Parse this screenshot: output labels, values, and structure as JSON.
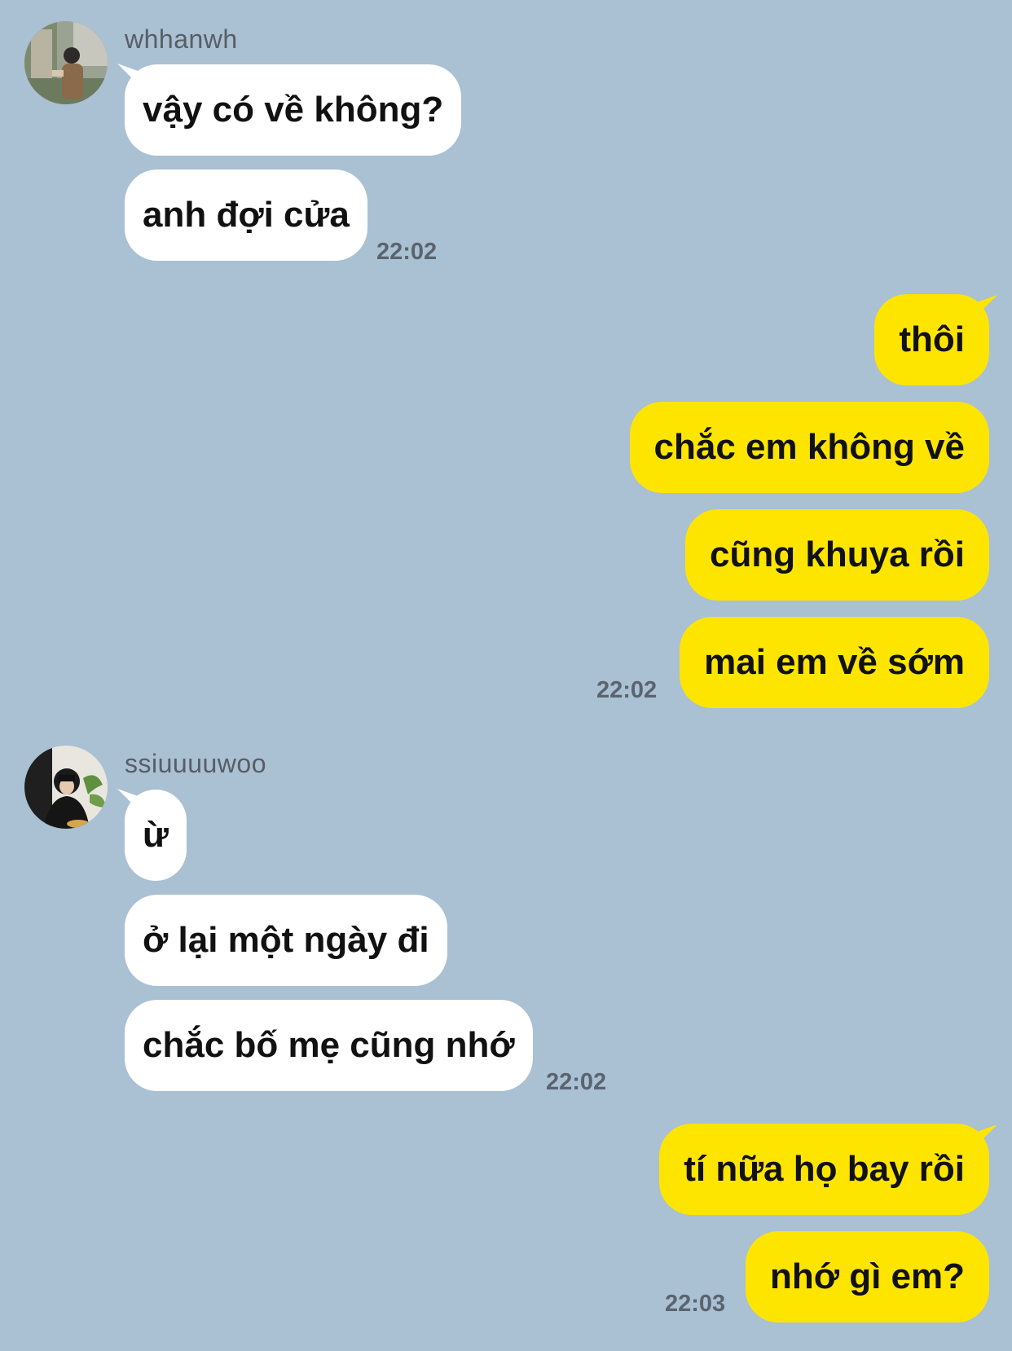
{
  "colors": {
    "background": "#aac0d3",
    "incoming_bubble": "#ffffff",
    "outgoing_bubble": "#fee500",
    "sender_name": "#575e66",
    "timestamp": "#5a6470"
  },
  "groups": [
    {
      "direction": "incoming",
      "sender": "whhanwh",
      "avatar_icon": "profile-photo-man-street",
      "messages": [
        "vậy có về không?",
        "anh đợi cửa"
      ],
      "time": "22:02"
    },
    {
      "direction": "outgoing",
      "messages": [
        "thôi",
        "chắc em không về",
        "cũng khuya rồi",
        "mai em về sớm"
      ],
      "time": "22:02"
    },
    {
      "direction": "incoming",
      "sender": "ssiuuuuwoo",
      "avatar_icon": "profile-photo-woman-hood",
      "messages": [
        "ừ",
        "ở lại một ngày đi",
        "chắc bố mẹ cũng nhớ"
      ],
      "time": "22:02"
    },
    {
      "direction": "outgoing",
      "messages": [
        "tí nữa họ bay rồi",
        "nhớ gì em?"
      ],
      "time": "22:03"
    }
  ]
}
